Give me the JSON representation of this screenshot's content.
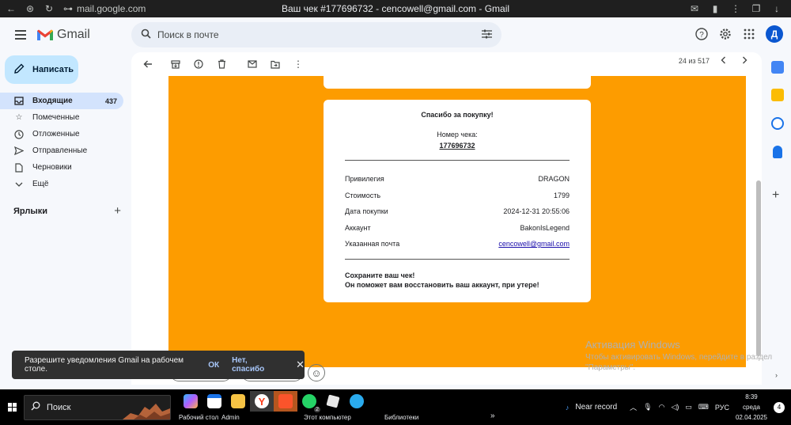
{
  "browser": {
    "url": "mail.google.com",
    "tab_title": "Ваш чек #177696732 - cencowell@gmail.com - Gmail"
  },
  "gmail": {
    "logo_text": "Gmail",
    "search_placeholder": "Поиск в почте",
    "avatar_letter": "Д",
    "compose_label": "Написать"
  },
  "sidebar": {
    "items": [
      {
        "label": "Входящие",
        "count": "437",
        "icon": "inbox-icon"
      },
      {
        "label": "Помеченные",
        "count": "",
        "icon": "star-icon"
      },
      {
        "label": "Отложенные",
        "count": "",
        "icon": "clock-icon"
      },
      {
        "label": "Отправленные",
        "count": "",
        "icon": "send-icon"
      },
      {
        "label": "Черновики",
        "count": "",
        "icon": "draft-icon"
      },
      {
        "label": "Ещё",
        "count": "",
        "icon": "chevron-down-icon"
      }
    ],
    "labels_title": "Ярлыки"
  },
  "toolbar": {
    "pager_text": "24 из 517"
  },
  "receipt": {
    "title": "Спасибо за покупку!",
    "check_label": "Номер чека:",
    "check_number": "177696732",
    "rows": [
      {
        "key": "Привилегия",
        "value": "DRAGON"
      },
      {
        "key": "Стоимость",
        "value": "1799"
      },
      {
        "key": "Дата покупки",
        "value": "2024-12-31 20:55:06"
      },
      {
        "key": "Аккаунт",
        "value": "BakonIsLegend"
      },
      {
        "key": "Указанная почта",
        "value": "cencowell@gmail.com"
      }
    ],
    "save_line1": "Сохраните ваш чек!",
    "save_line2": "Он поможет вам восстановить ваш аккаунт, при утере!"
  },
  "watermark": {
    "line1": "Активация Windows",
    "line2": "Чтобы активировать Windows, перейдите в раздел \"Параметры\"."
  },
  "toast": {
    "message": "Разрешите уведомления Gmail на рабочем столе.",
    "ok": "ОК",
    "no": "Нет, спасибо"
  },
  "taskbar": {
    "search_label": "Поиск",
    "label_desktop": "Рабочий стол",
    "label_admin": "Admin",
    "label_computer": "Этот компьютер",
    "label_libraries": "Библиотеки",
    "whatsapp_badge": "2",
    "media": "Near record",
    "lang": "РУС",
    "time": "8:39",
    "day": "среда",
    "date": "02.04.2025",
    "notif_count": "4"
  }
}
